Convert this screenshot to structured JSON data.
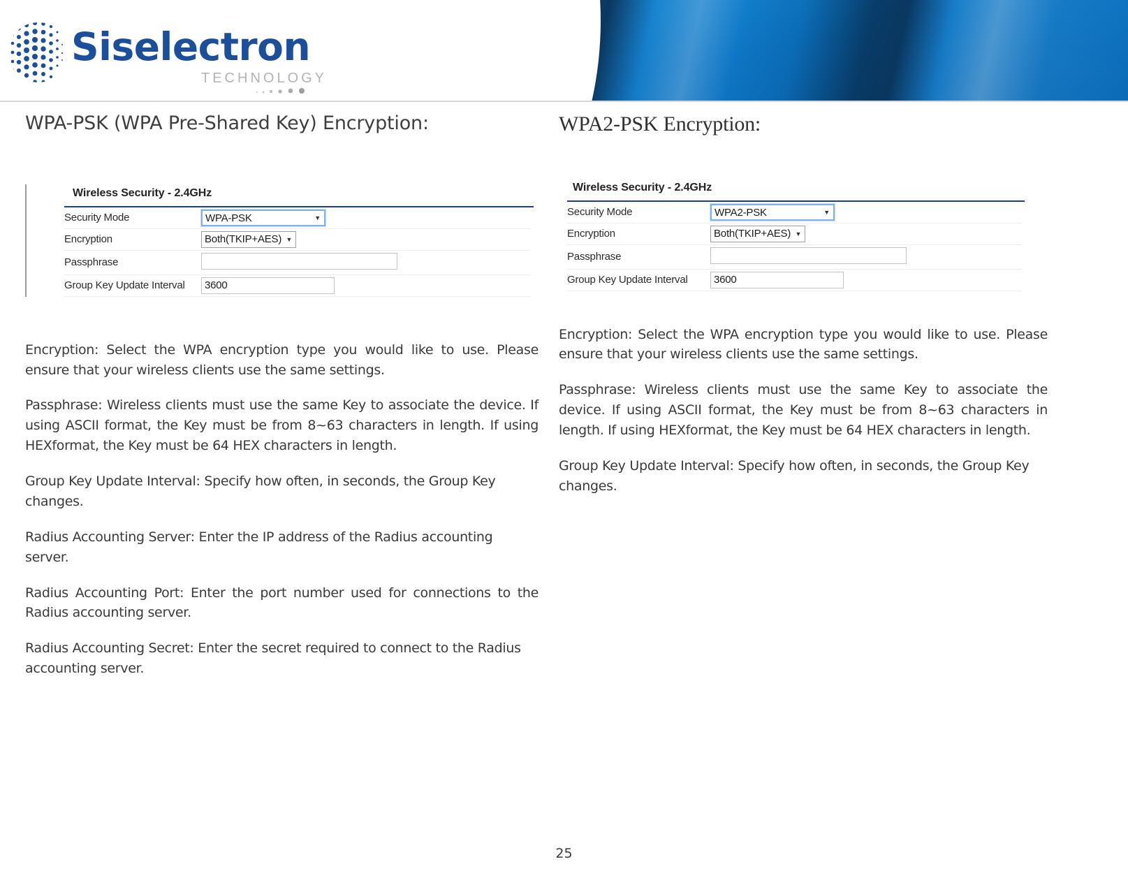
{
  "brand": {
    "name": "Siselectron",
    "tagline": "TECHNOLOGY",
    "logo_blue": "#1b4f9c",
    "banner_blue": "#0c7fd4"
  },
  "left_column": {
    "heading": "WPA-PSK (WPA Pre-Shared Key) Encryption:",
    "screenshot": {
      "title": "Wireless Security - 2.4GHz",
      "accent_line_color": "#1b3c92",
      "rows": [
        {
          "label": "Security Mode",
          "control": "select",
          "value": "WPA-PSK"
        },
        {
          "label": "Encryption",
          "control": "select",
          "value": "Both(TKIP+AES)"
        },
        {
          "label": "Passphrase",
          "control": "text",
          "value": ""
        },
        {
          "label": "Group Key Update Interval",
          "control": "text",
          "value": "3600"
        }
      ]
    },
    "paragraphs": [
      "Encryption: Select   the   WPA  encryption type    you   would   like to    use. Please ensure that   your  wireless  clients   use   the same  settings.",
      "Passphrase:  Wireless    clients    must    use    the    same    Key to associate the    device.    If   using    ASCII   format,    the    Key   must   be   from   8~63 characters  in  length.    If  using   HEXformat,  the  Key  must   be   64   HEX characters in length.",
      "Group  Key Update Interval: Specify  how  often,  in seconds, the  Group Key changes.",
      "Radius   Accounting  Server: Enter   the   IP address  of  the Radius  accounting server.",
      "Radius     Accounting  Port:    Enter     the     port     number     used     for connections to  the  Radius  accounting server.",
      "Radius  Accounting  Secret:  Enter   the   secret  required   to connect to  the  Radius  accounting server."
    ]
  },
  "right_column": {
    "heading": "WPA2-PSK Encryption:",
    "screenshot": {
      "title": "Wireless Security - 2.4GHz",
      "accent_line_color": "#1b3c92",
      "rows": [
        {
          "label": "Security Mode",
          "control": "select",
          "value": "WPA2-PSK"
        },
        {
          "label": "Encryption",
          "control": "select",
          "value": "Both(TKIP+AES)"
        },
        {
          "label": "Passphrase",
          "control": "text",
          "value": ""
        },
        {
          "label": "Group Key Update Interval",
          "control": "text",
          "value": "3600"
        }
      ]
    },
    "paragraphs": [
      "Encryption: Select   the   WPA encryption type   you  would like to  use. Please ensure that   your  wireless clients   use the  same  settings.",
      "Passphrase:  Wireless   clients   must   use   the   same   Key to associate the   device.   If  using   ASCII  format,   the   Key  must  be   from   8~63 characters in  length.   If  using   HEXformat, the   Key must   be  64  HEX characters in length.",
      "Group    Key   Update   Interval: Specify    how    often,    in seconds, the Group Key changes."
    ]
  },
  "footer": {
    "page_number": "25"
  }
}
